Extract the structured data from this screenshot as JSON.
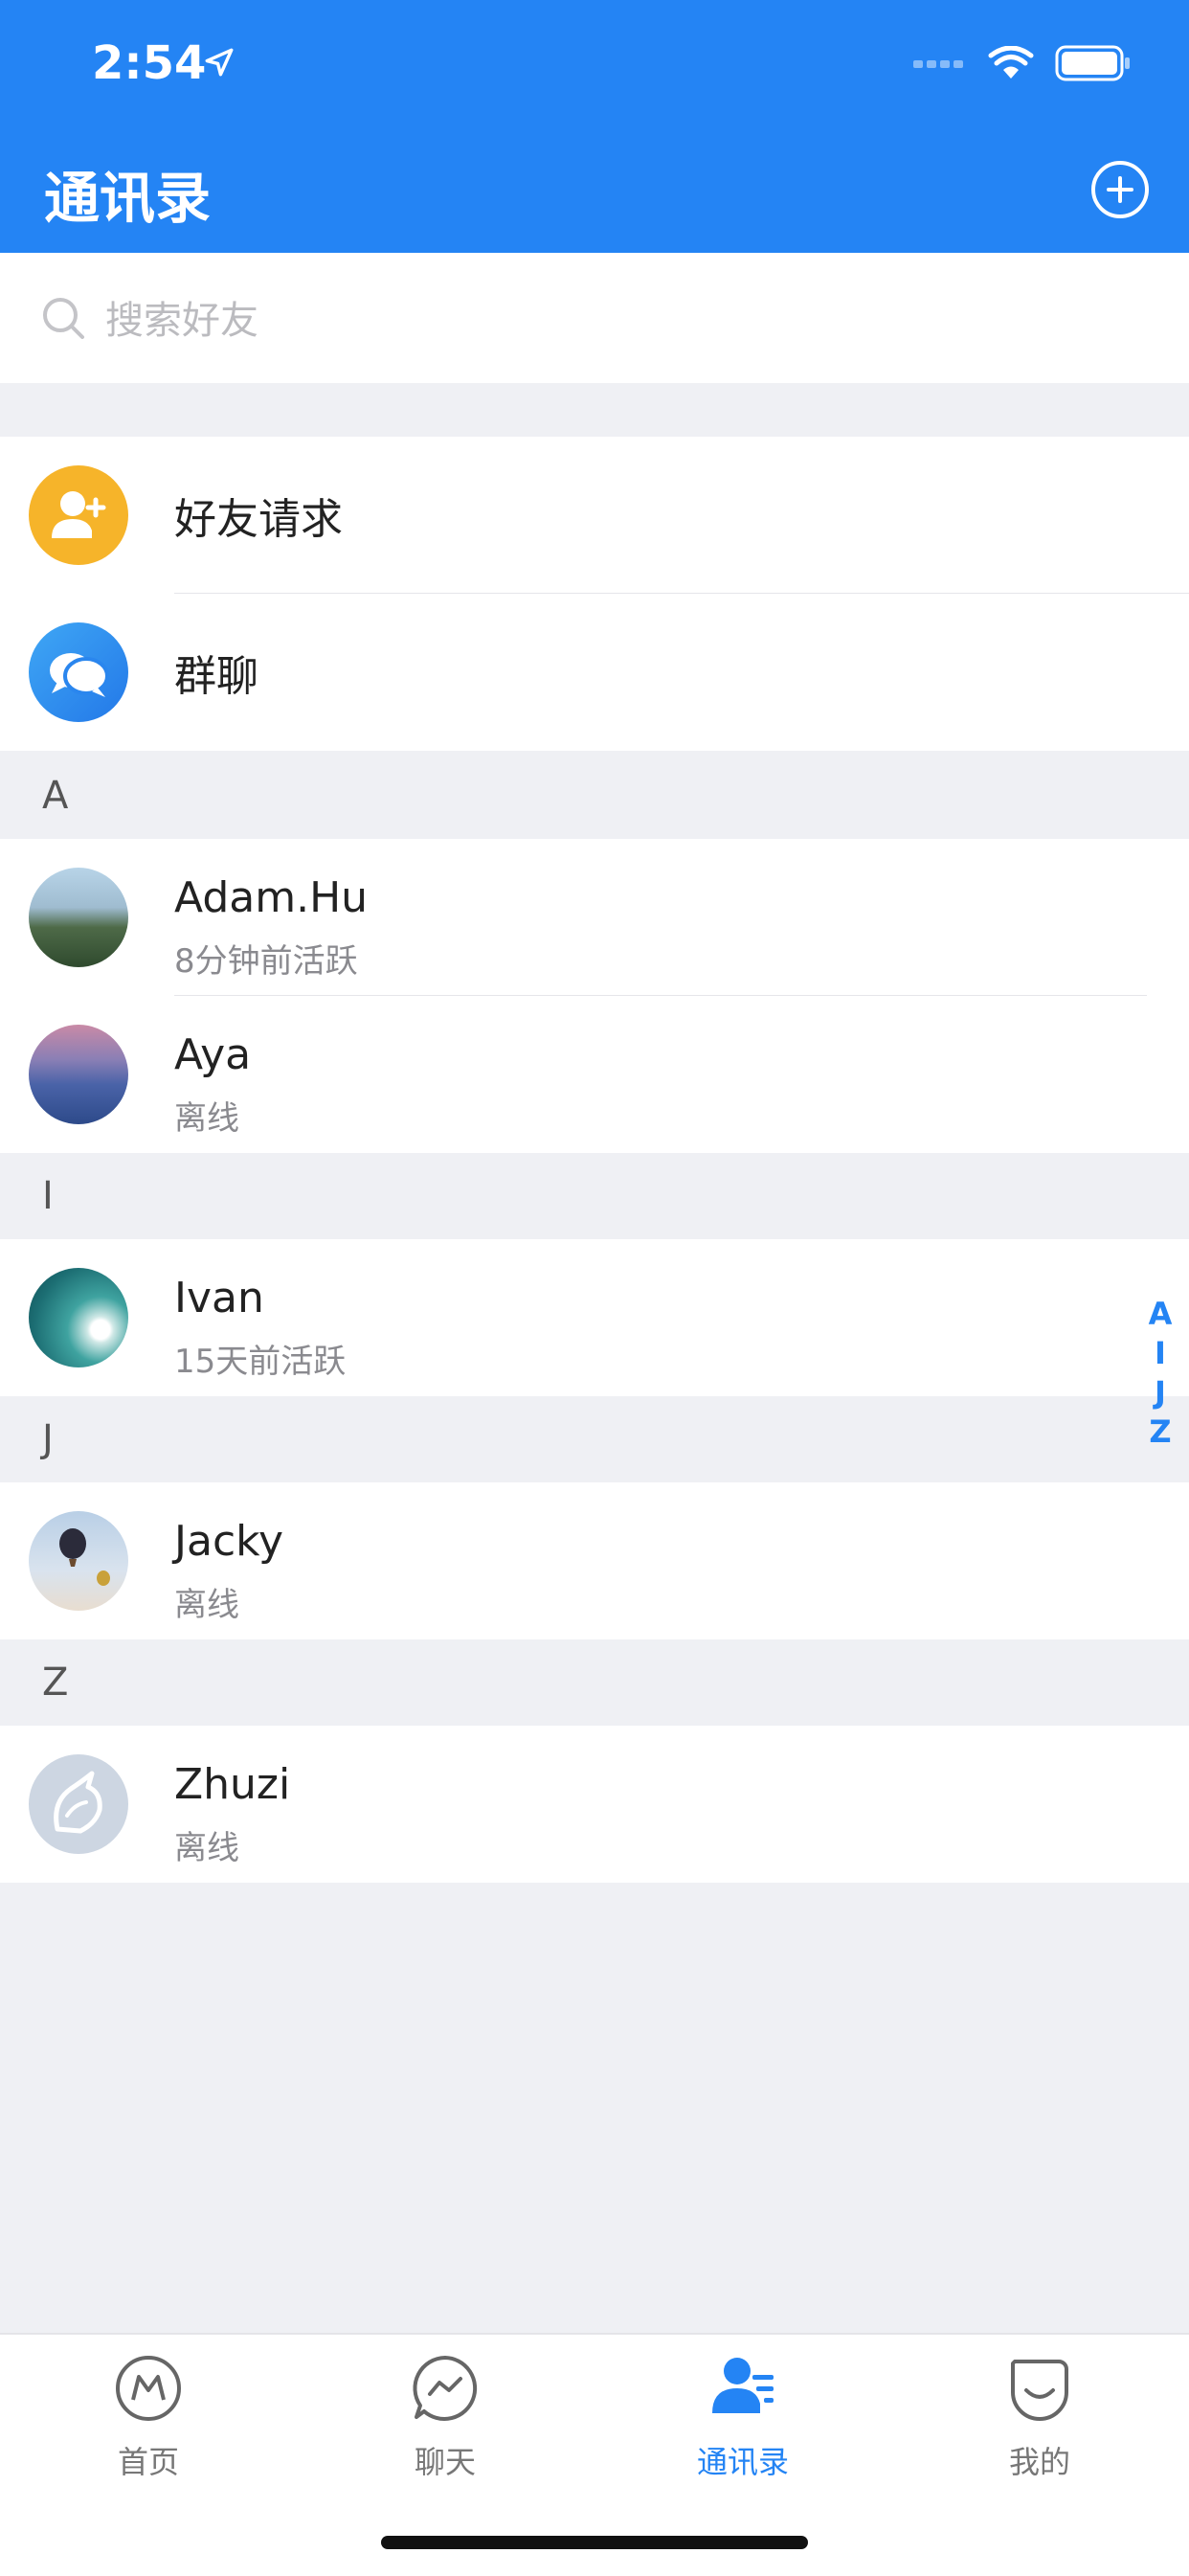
{
  "status": {
    "time": "2:54"
  },
  "header": {
    "title": "通讯录"
  },
  "search": {
    "placeholder": "搜索好友"
  },
  "shortcuts": [
    {
      "label": "好友请求",
      "icon": "add-friend-icon",
      "color": "#f6b42a"
    },
    {
      "label": "群聊",
      "icon": "group-chat-icon",
      "color": "#2e8ef0"
    }
  ],
  "sections": [
    {
      "letter": "A",
      "contacts": [
        {
          "name": "Adam.Hu",
          "status": "8分钟前活跃"
        },
        {
          "name": "Aya",
          "status": "离线"
        }
      ]
    },
    {
      "letter": "I",
      "contacts": [
        {
          "name": "Ivan",
          "status": "15天前活跃"
        }
      ]
    },
    {
      "letter": "J",
      "contacts": [
        {
          "name": "Jacky",
          "status": "离线"
        }
      ]
    },
    {
      "letter": "Z",
      "contacts": [
        {
          "name": "Zhuzi",
          "status": "离线"
        }
      ]
    }
  ],
  "index_letters": [
    "A",
    "I",
    "J",
    "Z"
  ],
  "tabs": [
    {
      "label": "首页",
      "icon": "home-icon",
      "active": false
    },
    {
      "label": "聊天",
      "icon": "chat-icon",
      "active": false
    },
    {
      "label": "通讯录",
      "icon": "contacts-icon",
      "active": true
    },
    {
      "label": "我的",
      "icon": "profile-icon",
      "active": false
    }
  ],
  "colors": {
    "primary": "#2484f4",
    "background": "#eff0f4"
  }
}
